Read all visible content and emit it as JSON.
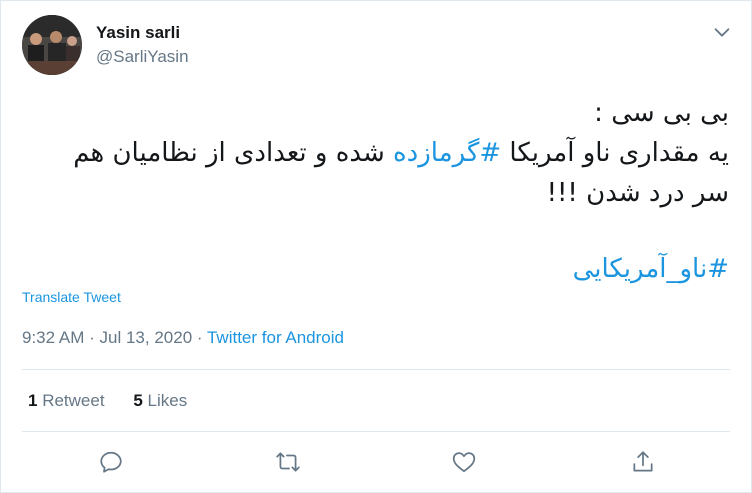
{
  "tweet": {
    "author_name": "Yasin sarli",
    "author_handle": "@SarliYasin",
    "lines": [
      "بی بی سی :",
      "شده و تعدادی از نظامیان هم",
      "سر درد شدن !!!"
    ],
    "line2_prefix": "یه مقداری ناو آمریکا ",
    "hashtag_inline": "#گرمازده",
    "hashtag_footer": "#ناو_آمریکایی",
    "translate_label": "Translate Tweet",
    "time": "9:32 AM",
    "date": "Jul 13, 2020",
    "separator": "·",
    "source": "Twitter for Android",
    "retweet_count": "1",
    "retweet_label": "Retweet",
    "likes_count": "5",
    "likes_label": "Likes"
  },
  "icons": {
    "more": "chevron-down-icon",
    "reply": "reply-icon",
    "retweet": "retweet-icon",
    "like": "heart-icon",
    "share": "share-icon"
  },
  "colors": {
    "link": "#1b95e0",
    "muted": "#657786",
    "text": "#14171a",
    "border": "#e1e8ed"
  }
}
